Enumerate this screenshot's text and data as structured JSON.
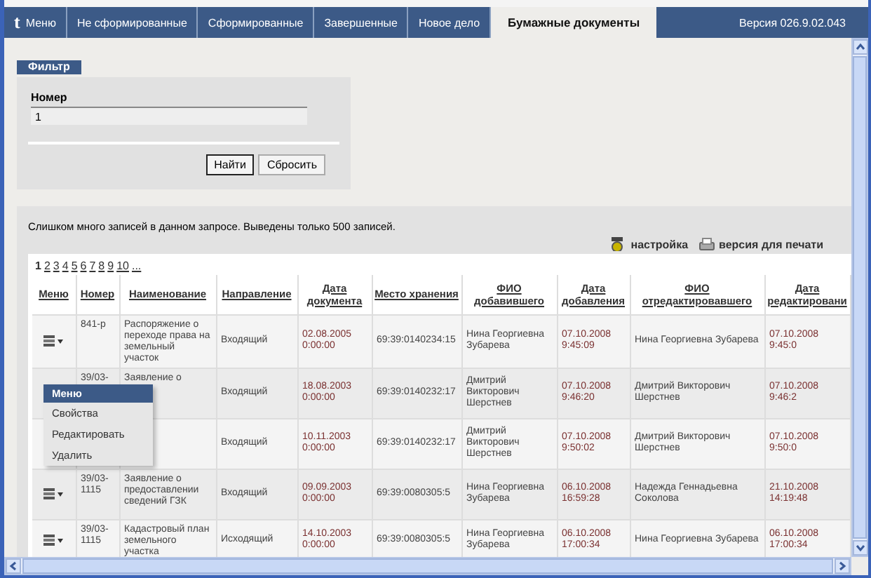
{
  "tabs": [
    {
      "kind": "logo",
      "logo": "t",
      "label": "Меню",
      "selected": false
    },
    {
      "kind": "tab",
      "label": "Не сформированные",
      "selected": false
    },
    {
      "kind": "tab",
      "label": "Сформированные",
      "selected": false
    },
    {
      "kind": "tab",
      "label": "Завершенные",
      "selected": false
    },
    {
      "kind": "tab",
      "label": "Новое дело",
      "selected": false
    },
    {
      "kind": "tab",
      "label": "Бумажные документы",
      "selected": true
    }
  ],
  "version": "Версия 026.9.02.043",
  "filter": {
    "title": "Фильтр",
    "field_label": "Номер",
    "value": "1",
    "buttons": [
      {
        "label": "Найти",
        "selected": true
      },
      {
        "label": "Сбросить",
        "selected": false
      }
    ]
  },
  "notice": "Слишком много записей в данном запросе. Выведены только 500 записей.",
  "links": [
    {
      "kind": "settings",
      "label": "настройка"
    },
    {
      "kind": "print",
      "label": "версия для печати"
    }
  ],
  "pages": [
    {
      "label": "1",
      "selected": true
    },
    {
      "label": "2",
      "selected": false
    },
    {
      "label": "3",
      "selected": false
    },
    {
      "label": "4",
      "selected": false
    },
    {
      "label": "5",
      "selected": false
    },
    {
      "label": "6",
      "selected": false
    },
    {
      "label": "7",
      "selected": false
    },
    {
      "label": "8",
      "selected": false
    },
    {
      "label": "9",
      "selected": false
    },
    {
      "label": "10",
      "selected": false
    },
    {
      "label": "...",
      "selected": false
    }
  ],
  "table": {
    "columns": [
      "Меню",
      "Номер",
      "Наименование",
      "Направление",
      "Дата документа",
      "Место хранения",
      "ФИО добавившего",
      "Дата добавления",
      "ФИО отредактировавшего",
      "Дата редактировани"
    ],
    "rows": [
      {
        "number": "841-р",
        "name": "Распоряжение о переходе права на земельный участок",
        "direction": "Входящий",
        "doc_date": "02.08.2005 0:00:00",
        "storage": "69:39:0140234:15",
        "added_by": "Нина Георгиевна Зубарева",
        "added_date": "07.10.2008 9:45:09",
        "edited_by": "Нина Георгиевна Зубарева",
        "edited_date": "07.10.2008 9:45:0"
      },
      {
        "number": "39/03-",
        "name": "Заявление о",
        "direction": "Входящий",
        "doc_date": "18.08.2003 0:00:00",
        "storage": "69:39:0140232:17",
        "added_by": "Дмитрий Викторович Шерстнев",
        "added_date": "07.10.2008 9:46:20",
        "edited_by": "Дмитрий Викторович Шерстнев",
        "edited_date": "07.10.2008 9:46:2"
      },
      {
        "direction": "Входящий",
        "doc_date": "10.11.2003 0:00:00",
        "storage": "69:39:0140232:17",
        "added_by": "Дмитрий Викторович Шерстнев",
        "added_date": "07.10.2008 9:50:02",
        "edited_by": "Дмитрий Викторович Шерстнев",
        "edited_date": "07.10.2008 9:50:0"
      },
      {
        "number": "39/03-1115",
        "name": "Заявление о предоставлении сведений ГЗК",
        "direction": "Входящий",
        "doc_date": "09.09.2003 0:00:00",
        "storage": "69:39:0080305:5",
        "added_by": "Нина Георгиевна Зубарева",
        "added_date": "06.10.2008 16:59:28",
        "edited_by": "Надежда Геннадьевна Соколова",
        "edited_date": "21.10.2008 14:19:48"
      },
      {
        "number": "39/03-1115",
        "name": "Кадастровый план земельного участка",
        "direction": "Исходящий",
        "doc_date": "14.10.2003 0:00:00",
        "storage": "69:39:0080305:5",
        "added_by": "Нина Георгиевна Зубарева",
        "added_date": "06.10.2008 17:00:34",
        "edited_by": "Нина Георгиевна Зубарева",
        "edited_date": "06.10.2008 17:00:34"
      }
    ]
  },
  "context_menu": {
    "title": "Меню",
    "items": [
      "Свойства",
      "Редактировать",
      "Удалить"
    ]
  }
}
